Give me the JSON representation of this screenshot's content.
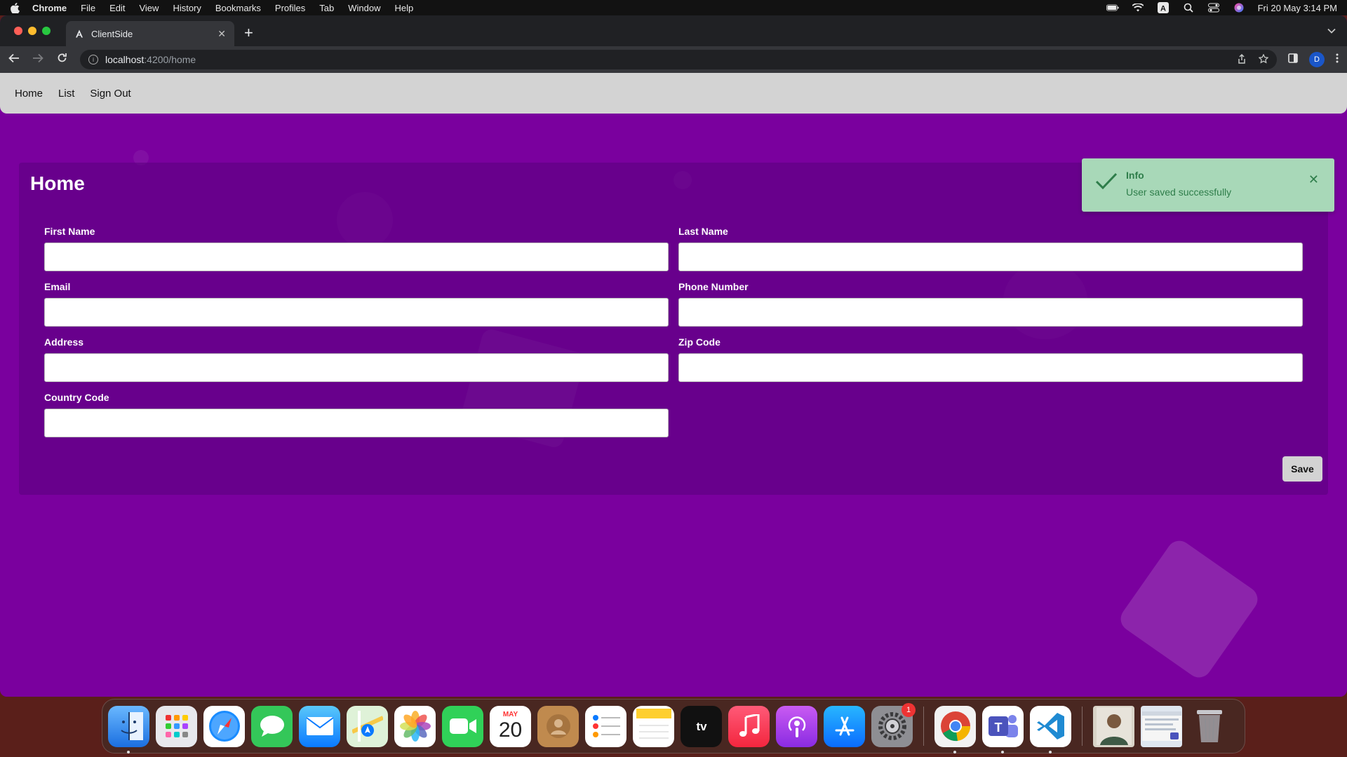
{
  "menubar": {
    "app_name": "Chrome",
    "items": [
      "File",
      "Edit",
      "View",
      "History",
      "Bookmarks",
      "Profiles",
      "Tab",
      "Window",
      "Help"
    ],
    "datetime": "Fri 20 May  3:14 PM"
  },
  "browser": {
    "tab_title": "ClientSide",
    "url_host": "localhost",
    "url_path": ":4200/home",
    "profile_initial": "D"
  },
  "app_nav": {
    "links": [
      "Home",
      "List",
      "Sign Out"
    ]
  },
  "form": {
    "heading": "Home",
    "fields": {
      "first_name": {
        "label": "First Name",
        "value": ""
      },
      "last_name": {
        "label": "Last Name",
        "value": ""
      },
      "email": {
        "label": "Email",
        "value": ""
      },
      "phone_number": {
        "label": "Phone Number",
        "value": ""
      },
      "address": {
        "label": "Address",
        "value": ""
      },
      "zip_code": {
        "label": "Zip Code",
        "value": ""
      },
      "country_code": {
        "label": "Country Code",
        "value": ""
      }
    },
    "save_label": "Save"
  },
  "toast": {
    "title": "Info",
    "message": "User saved successfully"
  },
  "dock": {
    "calendar_month": "MAY",
    "calendar_day": "20",
    "settings_badge": "1",
    "apps": [
      "finder-icon",
      "launchpad-icon",
      "safari-icon",
      "messages-icon",
      "mail-icon",
      "maps-icon",
      "photos-icon",
      "facetime-icon",
      "calendar-icon",
      "contacts-icon",
      "reminders-icon",
      "notes-icon",
      "tv-icon",
      "music-icon",
      "podcasts-icon",
      "app-store-icon",
      "system-preferences-icon",
      "chrome-icon",
      "teams-icon",
      "vscode-icon",
      "photo-thumbnail-icon",
      "window-thumbnail-icon",
      "trash-icon"
    ]
  },
  "colors": {
    "page_background": "#7a009e",
    "nav_background": "#d3d3d3",
    "toast_background": "#a8d8b8",
    "toast_text": "#2e7d4a"
  }
}
